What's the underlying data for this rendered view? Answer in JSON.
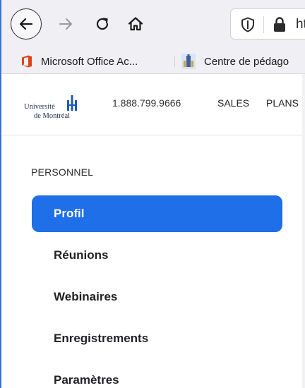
{
  "browser": {
    "url_fragment": "ht",
    "bookmarks": [
      {
        "label": "Microsoft Office Ac...",
        "icon": "office-icon"
      },
      {
        "label": "Centre de pédago",
        "icon": "building-icon"
      }
    ]
  },
  "site": {
    "logo_line1": "Université",
    "logo_line2": "de Montréal",
    "phone": "1.888.799.9666",
    "nav": [
      "SALES",
      "PLANS"
    ]
  },
  "sidebar": {
    "section_label": "PERSONNEL",
    "items": [
      {
        "label": "Profil",
        "active": true
      },
      {
        "label": "Réunions",
        "active": false
      },
      {
        "label": "Webinaires",
        "active": false
      },
      {
        "label": "Enregistrements",
        "active": false
      },
      {
        "label": "Paramètres",
        "active": false
      }
    ]
  },
  "colors": {
    "accent": "#1f6fe8",
    "toolbar_bg": "#f0f0f4",
    "frame_border": "#3a6fd8"
  }
}
